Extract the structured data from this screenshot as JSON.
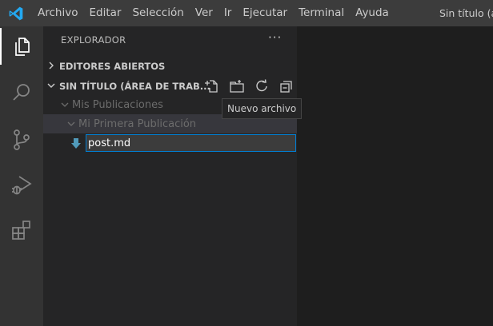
{
  "menu": [
    "Archivo",
    "Editar",
    "Selección",
    "Ver",
    "Ir",
    "Ejecutar",
    "Terminal",
    "Ayuda"
  ],
  "window_title": "Sin título (á",
  "activity_bar": {
    "items": [
      "explorer-icon",
      "search-icon",
      "source-control-icon",
      "run-debug-icon",
      "extensions-icon"
    ],
    "active": "explorer-icon"
  },
  "explorer": {
    "title": "EXPLORADOR",
    "more": "···",
    "open_editors": "EDITORES ABIERTOS",
    "workspace": "SIN TÍTULO (ÁREA DE TRAB...",
    "tree": [
      {
        "label": "Mis Publicaciones",
        "expanded": true
      },
      {
        "label": "Mi Primera Publicación",
        "expanded": true,
        "selected": true
      }
    ],
    "new_file_value": "post.md",
    "tooltip": "Nuevo archivo"
  },
  "colors": {
    "accent": "#007acc",
    "focus_border": "#007fd4",
    "titlebar": "#3c3c3c",
    "activitybar": "#333333",
    "sidebar": "#252526",
    "editor": "#1e1e1e"
  }
}
